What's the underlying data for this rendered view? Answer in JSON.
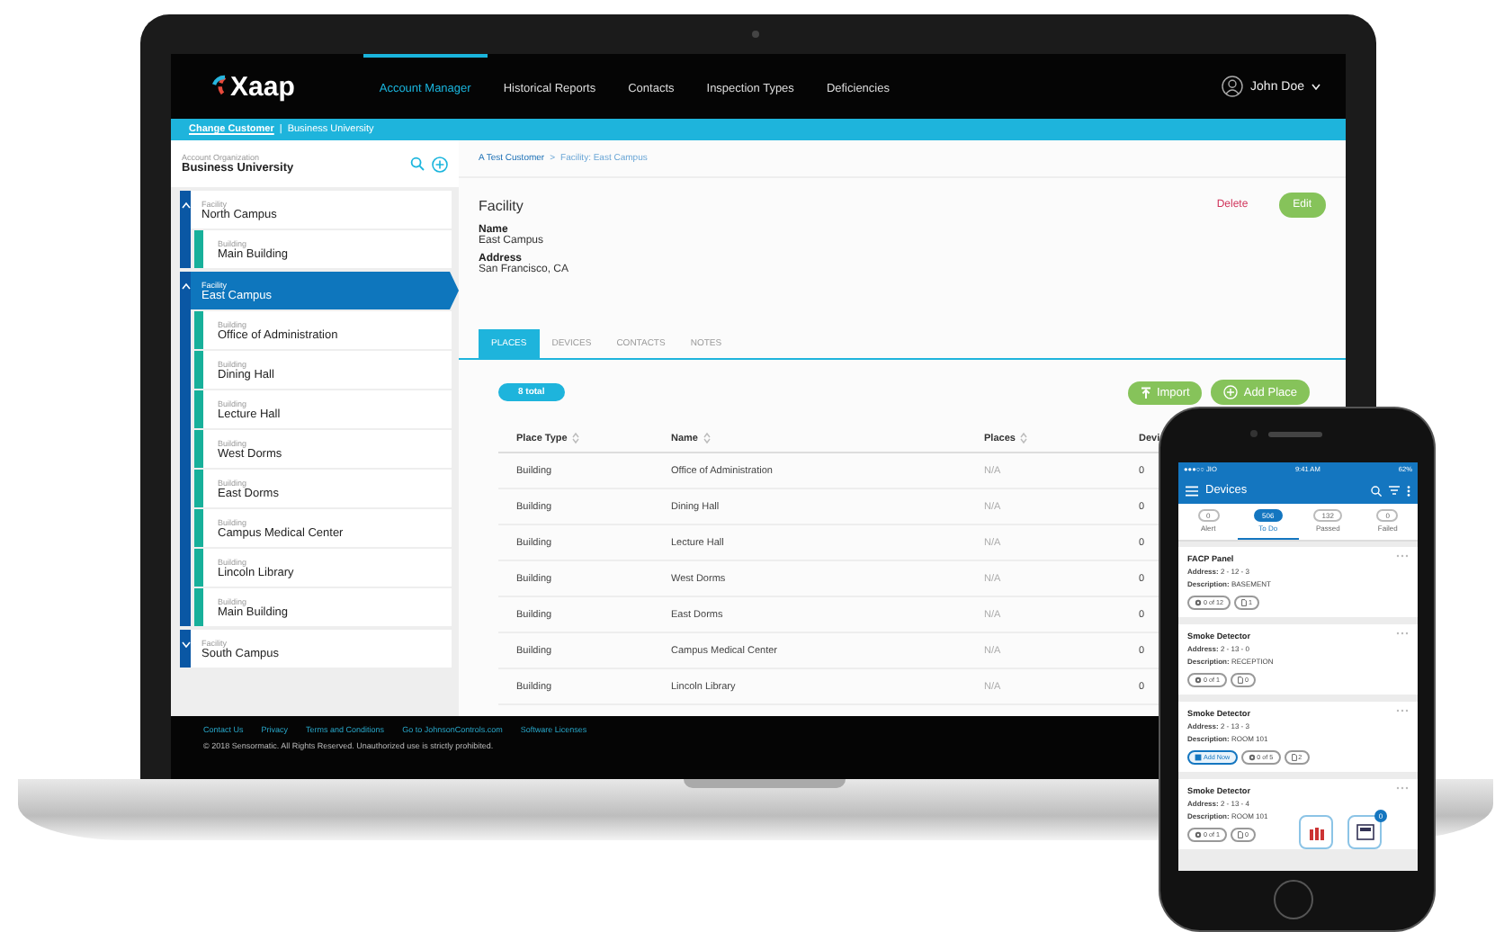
{
  "laptop": {
    "nav": {
      "logo": "Xaap",
      "items": [
        {
          "label": "Account Manager",
          "selected": true
        },
        {
          "label": "Historical Reports",
          "selected": false
        },
        {
          "label": "Contacts",
          "selected": false
        },
        {
          "label": "Inspection Types",
          "selected": false
        },
        {
          "label": "Deficiencies",
          "selected": false
        }
      ],
      "user": "John Doe"
    },
    "customer_bar": {
      "link": "Change Customer",
      "separator": "|",
      "customer": "Business University"
    },
    "sidebar": {
      "caption": "Account Organization",
      "title": "Business University",
      "tree": [
        {
          "type_label": "Facility",
          "name": "North Campus",
          "expanded": true,
          "selected": false,
          "children": [
            {
              "type_label": "Building",
              "name": "Main Building",
              "selected": false
            }
          ]
        },
        {
          "type_label": "Facility",
          "name": "East Campus",
          "expanded": true,
          "selected": true,
          "children": [
            {
              "type_label": "Building",
              "name": "Office of Administration",
              "selected": false
            },
            {
              "type_label": "Building",
              "name": "Dining Hall",
              "selected": false
            },
            {
              "type_label": "Building",
              "name": "Lecture Hall",
              "selected": false
            },
            {
              "type_label": "Building",
              "name": "West Dorms",
              "selected": false
            },
            {
              "type_label": "Building",
              "name": "East Dorms",
              "selected": false
            },
            {
              "type_label": "Building",
              "name": "Campus Medical Center",
              "selected": false
            },
            {
              "type_label": "Building",
              "name": "Lincoln Library",
              "selected": false
            },
            {
              "type_label": "Building",
              "name": "Main Building",
              "selected": false
            }
          ]
        },
        {
          "type_label": "Facility",
          "name": "South Campus",
          "expanded": false,
          "selected": false
        }
      ]
    },
    "breadcrumb": {
      "items": [
        "A Test Customer",
        "Facility: East Campus"
      ],
      "separator": ">"
    },
    "facility": {
      "title": "Facility",
      "delete": "Delete",
      "edit": "Edit",
      "fields": [
        {
          "label": "Name",
          "value": "East Campus"
        },
        {
          "label": "Address",
          "value": "San Francisco, CA"
        }
      ]
    },
    "tabs": [
      {
        "label": "PLACES",
        "selected": true
      },
      {
        "label": "DEVICES",
        "selected": false
      },
      {
        "label": "CONTACTS",
        "selected": false
      },
      {
        "label": "NOTES",
        "selected": false
      }
    ],
    "total": "8 total",
    "import": "Import",
    "add_place": "Add Place",
    "table": {
      "columns": [
        "Place Type",
        "Name",
        "Places",
        "Devi"
      ],
      "rows": [
        [
          "Building",
          "Office of Administration",
          "N/A",
          "0"
        ],
        [
          "Building",
          "Dining Hall",
          "N/A",
          "0"
        ],
        [
          "Building",
          "Lecture Hall",
          "N/A",
          "0"
        ],
        [
          "Building",
          "West Dorms",
          "N/A",
          "0"
        ],
        [
          "Building",
          "East Dorms",
          "N/A",
          "0"
        ],
        [
          "Building",
          "Campus Medical Center",
          "N/A",
          "0"
        ],
        [
          "Building",
          "Lincoln Library",
          "N/A",
          "0"
        ]
      ]
    },
    "footer": {
      "links": [
        "Contact Us",
        "Privacy",
        "Terms and Conditions",
        "Go to JohnsonControls.com",
        "Software Licenses"
      ],
      "copyright": "© 2018 Sensormatic. All Rights Reserved. Unauthorized use is strictly prohibited."
    }
  },
  "phone": {
    "status": {
      "carrier": "●●●○○ JIO",
      "time": "9:41 AM",
      "battery": "62%"
    },
    "title": "Devices",
    "tabs": [
      {
        "count": "0",
        "label": "Alert",
        "selected": false
      },
      {
        "count": "506",
        "label": "To Do",
        "selected": true
      },
      {
        "count": "132",
        "label": "Passed",
        "selected": false
      },
      {
        "count": "0",
        "label": "Failed",
        "selected": false
      }
    ],
    "cards": [
      {
        "title": "FACP Panel",
        "address_label": "Address:",
        "address": "2 - 12 - 3",
        "description_label": "Description:",
        "description": "BASEMENT",
        "chips": [
          {
            "kind": "gear",
            "label": "0 of 12"
          },
          {
            "kind": "doc",
            "label": "1"
          }
        ]
      },
      {
        "title": "Smoke Detector",
        "address_label": "Address:",
        "address": "2 - 13 - 0",
        "description_label": "Description:",
        "description": "RECEPTION",
        "chips": [
          {
            "kind": "gear",
            "label": "0 of 1"
          },
          {
            "kind": "doc",
            "label": "0"
          }
        ]
      },
      {
        "title": "Smoke Detector",
        "address_label": "Address:",
        "address": "2 - 13 - 3",
        "description_label": "Description:",
        "description": "ROOM 101",
        "chips": [
          {
            "kind": "add",
            "label": "Add Now"
          },
          {
            "kind": "gear",
            "label": "0 of 5"
          },
          {
            "kind": "doc",
            "label": "2"
          }
        ]
      },
      {
        "title": "Smoke Detector",
        "address_label": "Address:",
        "address": "2 - 13 - 4",
        "description_label": "Description:",
        "description": "ROOM 101",
        "chips": [
          {
            "kind": "gear",
            "label": "0 of 1"
          },
          {
            "kind": "doc",
            "label": "0"
          }
        ]
      }
    ],
    "badge": "0"
  }
}
